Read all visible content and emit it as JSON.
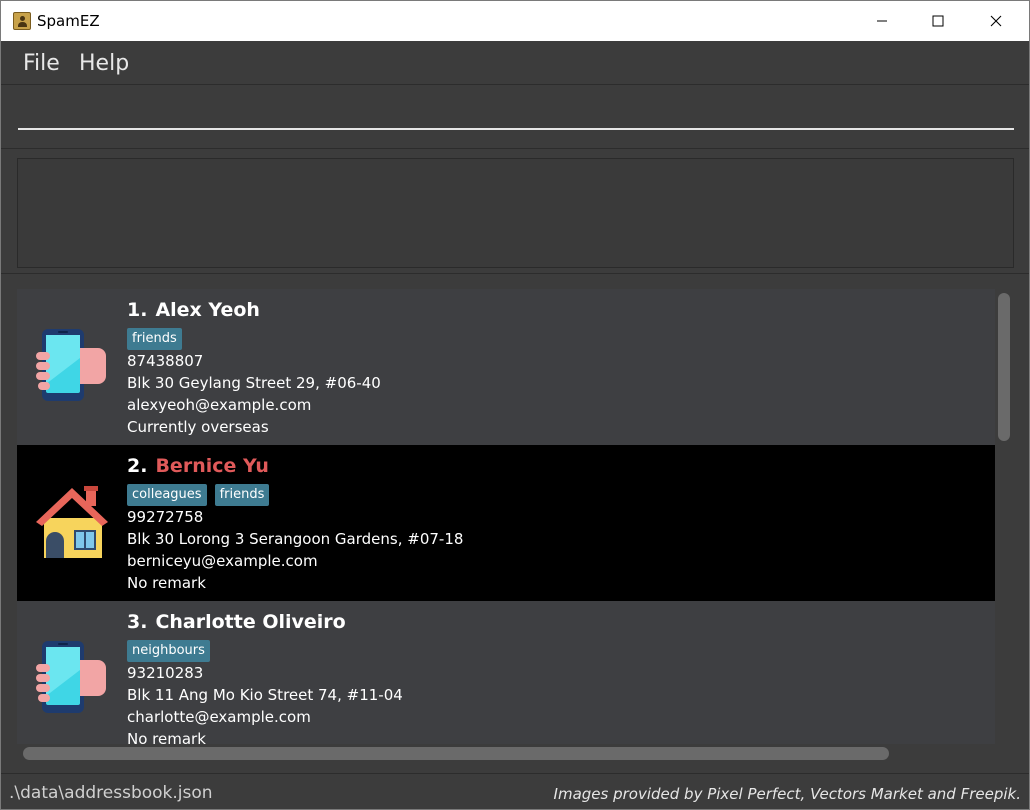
{
  "window": {
    "title": "SpamEZ"
  },
  "menu": {
    "file": "File",
    "help": "Help"
  },
  "command": {
    "value": "",
    "placeholder": ""
  },
  "result": {
    "text": ""
  },
  "persons": [
    {
      "index": "1.",
      "name": "Alex Yeoh",
      "icon": "phone-in-hand-icon",
      "tags": [
        "friends"
      ],
      "phone": "87438807",
      "address": "Blk 30 Geylang Street 29, #06-40",
      "email": "alexyeoh@example.com",
      "remark": "Currently overseas",
      "selected": false
    },
    {
      "index": "2.",
      "name": "Bernice Yu",
      "icon": "house-icon",
      "tags": [
        "colleagues",
        "friends"
      ],
      "phone": "99272758",
      "address": "Blk 30 Lorong 3 Serangoon Gardens, #07-18",
      "email": "berniceyu@example.com",
      "remark": "No remark",
      "selected": true
    },
    {
      "index": "3.",
      "name": "Charlotte Oliveiro",
      "icon": "phone-in-hand-icon",
      "tags": [
        "neighbours"
      ],
      "phone": "93210283",
      "address": "Blk 11 Ang Mo Kio Street 74, #11-04",
      "email": "charlotte@example.com",
      "remark": "No remark",
      "selected": false
    }
  ],
  "status": {
    "path": ".\\data\\addressbook.json",
    "credit": "Images provided by Pixel Perfect, Vectors Market and Freepik."
  },
  "colors": {
    "selected_name": "#e05a5a",
    "tag_bg": "#3e7b91",
    "card_bg": "#3e3f42",
    "selected_bg": "#000000"
  }
}
